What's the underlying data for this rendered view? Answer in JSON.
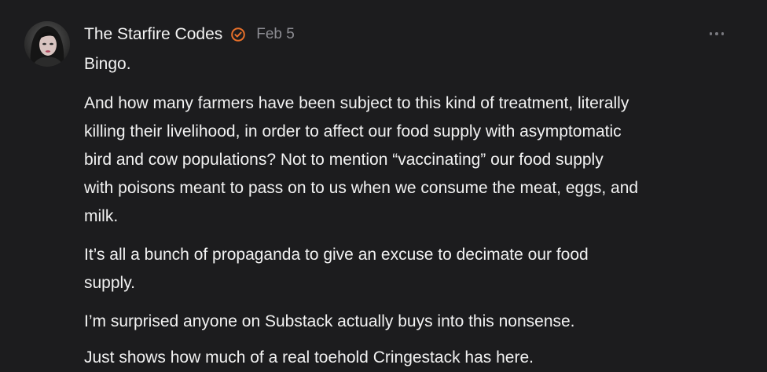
{
  "comment": {
    "author": "The Starfire Codes",
    "date": "Feb 5",
    "verified_icon": "verified-check-icon",
    "accent_color": "#e8702a",
    "more_icon": "more-horizontal-icon",
    "paragraphs": [
      "Bingo.",
      "And how many farmers have been subject to this kind of treatment, literally\nkilling their livelihood, in order to affect our food supply with asymptomatic\nbird and cow populations? Not to mention “vaccinating” our food supply\nwith poisons meant to pass on to us when we consume the meat, eggs, and\nmilk.",
      "It’s all a bunch of propaganda to give an excuse to decimate our food\nsupply.",
      "I’m surprised anyone on Substack actually buys into this nonsense.",
      "Just shows how much of a real toehold Cringestack has here."
    ]
  }
}
